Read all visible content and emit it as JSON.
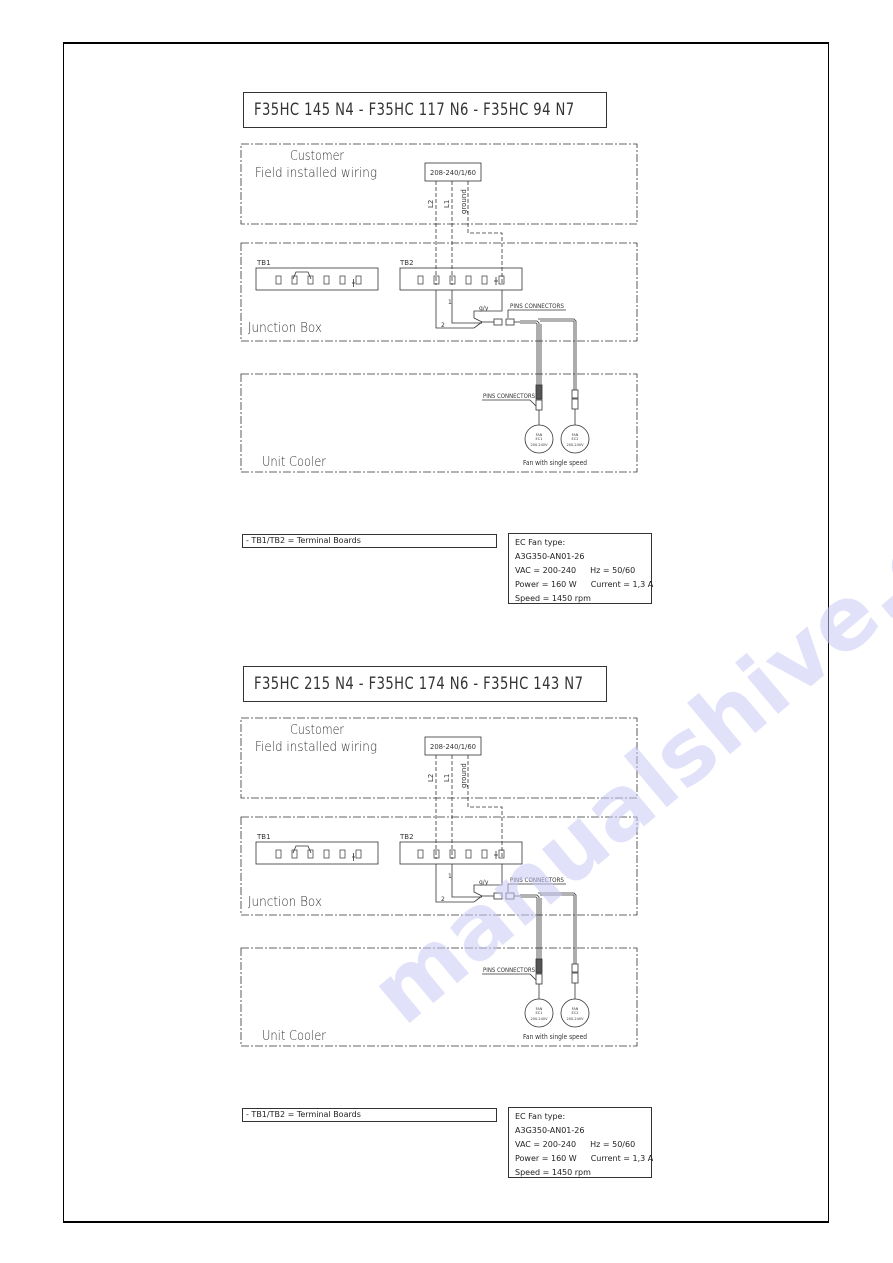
{
  "sections": [
    {
      "title": "F35HC 145 N4 - F35HC 117 N6 - F35HC 94 N7",
      "customer_label_1": "Customer",
      "customer_label_2": "Field installed wiring",
      "supply": "208-240/1/60",
      "wire_labels": [
        "L2",
        "L1",
        "ground"
      ],
      "tb1_label": "TB1",
      "tb2_label": "TB2",
      "junction_label": "Junction Box",
      "pins_connectors_jb": "PINS CONNECTORS",
      "pins_connectors_uc": "PINS CONNECTORS",
      "wire_num_1": "1",
      "wire_num_2": "2",
      "wire_gy": "g/y",
      "unit_cooler_label": "Unit Cooler",
      "fans": [
        {
          "l1": "FAN",
          "l2": "EC1",
          "l3": "200-240V"
        },
        {
          "l1": "FAN",
          "l2": "EC2",
          "l3": "200-240V"
        }
      ],
      "fan_caption": "Fan with single speed",
      "legend": "- TB1/TB2 = Terminal Boards",
      "spec": {
        "line1": "EC Fan type:",
        "line2": "A3G350-AN01-26",
        "vac": "VAC = 200-240",
        "hz": "Hz = 50/60",
        "power": "Power = 160 W",
        "current": "Current = 1,3 A",
        "speed": "Speed = 1450 rpm"
      }
    },
    {
      "title": "F35HC 215 N4 - F35HC 174 N6 - F35HC 143 N7",
      "customer_label_1": "Customer",
      "customer_label_2": "Field installed wiring",
      "supply": "208-240/1/60",
      "wire_labels": [
        "L2",
        "L1",
        "ground"
      ],
      "tb1_label": "TB1",
      "tb2_label": "TB2",
      "junction_label": "Junction Box",
      "pins_connectors_jb": "PINS CONNECTORS",
      "pins_connectors_uc": "PINS CONNECTORS",
      "wire_num_1": "1",
      "wire_num_2": "2",
      "wire_gy": "g/y",
      "unit_cooler_label": "Unit Cooler",
      "fans": [
        {
          "l1": "FAN",
          "l2": "EC1",
          "l3": "200-240V"
        },
        {
          "l1": "FAN",
          "l2": "EC2",
          "l3": "200-240V"
        }
      ],
      "fan_caption": "Fan with single speed",
      "legend": "- TB1/TB2 = Terminal Boards",
      "spec": {
        "line1": "EC Fan type:",
        "line2": "A3G350-AN01-26",
        "vac": "VAC = 200-240",
        "hz": "Hz = 50/60",
        "power": "Power = 160 W",
        "current": "Current = 1,3 A",
        "speed": "Speed = 1450 rpm"
      }
    }
  ],
  "watermark": "manualshive.com",
  "colors": {
    "line": "#333333",
    "watermark": "#c9c9f5"
  }
}
